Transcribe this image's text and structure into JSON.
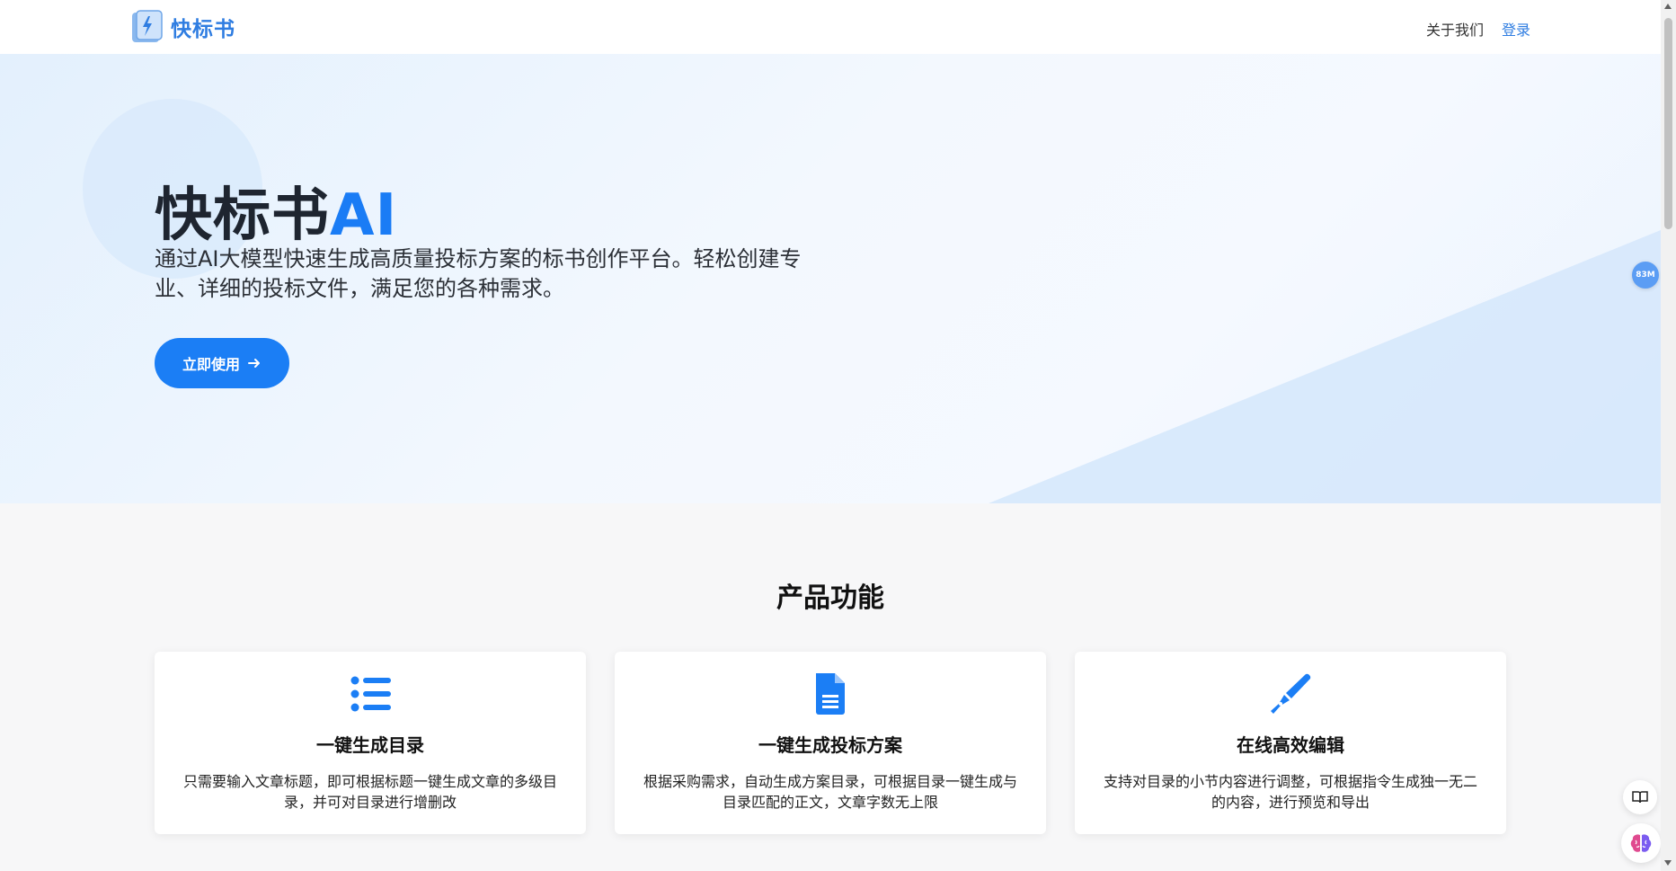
{
  "nav": {
    "brand_name": "快标书",
    "about_label": "关于我们",
    "login_label": "登录"
  },
  "hero": {
    "title_main": "快标书",
    "title_accent": "AI",
    "description": "通过AI大模型快速生成高质量投标方案的标书创作平台。轻松创建专业、详细的投标文件，满足您的各种需求。",
    "cta_label": "立即使用"
  },
  "features": {
    "section_title": "产品功能",
    "items": [
      {
        "icon": "list-icon",
        "title": "一键生成目录",
        "description": "只需要输入文章标题，即可根据标题一键生成文章的多级目录，并可对目录进行增删改"
      },
      {
        "icon": "document-icon",
        "title": "一键生成投标方案",
        "description": "根据采购需求，自动生成方案目录，可根据目录一键生成与目录匹配的正文，文章字数无上限"
      },
      {
        "icon": "pen-icon",
        "title": "在线高效编辑",
        "description": "支持对目录的小节内容进行调整，可根据指令生成独一无二的内容，进行预览和导出"
      }
    ]
  },
  "floating": {
    "badge_label": "83M"
  },
  "colors": {
    "brand": "#2f7de1",
    "accent": "#1b7ef5",
    "hero_bg": "#e3f0fd"
  }
}
